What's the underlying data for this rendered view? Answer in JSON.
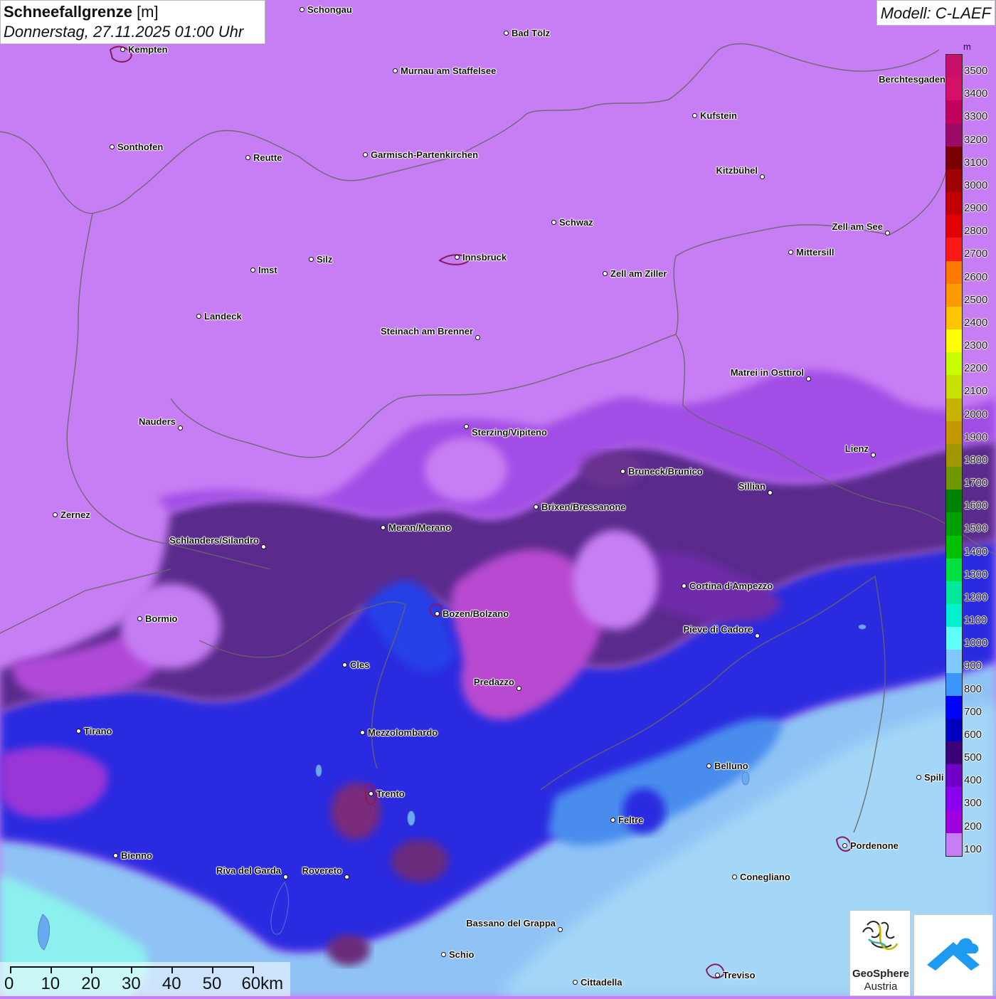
{
  "header": {
    "title_bold": "Schneefallgrenze",
    "title_unit": " [m]",
    "subtitle": "Donnerstag, 27.11.2025 01:00 Uhr",
    "model": "Modell: C-LAEF"
  },
  "cities": [
    {
      "name": "Schongau"
    },
    {
      "name": "Bad Tölz"
    },
    {
      "name": "Kempten"
    },
    {
      "name": "Murnau am Staffelsee"
    },
    {
      "name": "Berchtesgaden"
    },
    {
      "name": "Kufstein"
    },
    {
      "name": "Sonthofen"
    },
    {
      "name": "Reutte"
    },
    {
      "name": "Garmisch-Partenkirchen"
    },
    {
      "name": "Kitzbühel"
    },
    {
      "name": "Schwaz"
    },
    {
      "name": "Zell am See"
    },
    {
      "name": "Mittersill"
    },
    {
      "name": "Innsbruck"
    },
    {
      "name": "Silz"
    },
    {
      "name": "Imst"
    },
    {
      "name": "Zell am Ziller"
    },
    {
      "name": "Landeck"
    },
    {
      "name": "Steinach am Brenner"
    },
    {
      "name": "Matrei in Osttirol"
    },
    {
      "name": "Nauders"
    },
    {
      "name": "Sterzing/Vipiteno"
    },
    {
      "name": "Lienz"
    },
    {
      "name": "Bruneck/Brunico"
    },
    {
      "name": "Sillian"
    },
    {
      "name": "Brixen/Bressanone"
    },
    {
      "name": "Zernez"
    },
    {
      "name": "Meran/Merano"
    },
    {
      "name": "Schlanders/Silandro"
    },
    {
      "name": "Cortina d'Ampezzo"
    },
    {
      "name": "Bozen/Bolzano"
    },
    {
      "name": "Bormio"
    },
    {
      "name": "Pieve di Cadore"
    },
    {
      "name": "Cles"
    },
    {
      "name": "Predazzo"
    },
    {
      "name": "Tirano"
    },
    {
      "name": "Mezzolombardo"
    },
    {
      "name": "Belluno"
    },
    {
      "name": "Spili"
    },
    {
      "name": "Trento"
    },
    {
      "name": "Feltre"
    },
    {
      "name": "Pordenone"
    },
    {
      "name": "Bienno"
    },
    {
      "name": "Riva del Garda"
    },
    {
      "name": "Rovereto"
    },
    {
      "name": "Conegliano"
    },
    {
      "name": "Bassano del Grappa"
    },
    {
      "name": "Schio"
    },
    {
      "name": "Treviso"
    },
    {
      "name": "Cittadella"
    }
  ],
  "legend": {
    "unit": "m",
    "bands": [
      {
        "value": "3500",
        "color": "#c8106a"
      },
      {
        "value": "3400",
        "color": "#d41068"
      },
      {
        "value": "3300",
        "color": "#c2005e"
      },
      {
        "value": "3200",
        "color": "#9a0a66"
      },
      {
        "value": "3100",
        "color": "#7a0000"
      },
      {
        "value": "3000",
        "color": "#a00000"
      },
      {
        "value": "2900",
        "color": "#c20000"
      },
      {
        "value": "2800",
        "color": "#e20000"
      },
      {
        "value": "2700",
        "color": "#ff1818"
      },
      {
        "value": "2600",
        "color": "#ff7a00"
      },
      {
        "value": "2500",
        "color": "#ff9a00"
      },
      {
        "value": "2400",
        "color": "#ffc400"
      },
      {
        "value": "2300",
        "color": "#ffff00"
      },
      {
        "value": "2200",
        "color": "#c8ff00"
      },
      {
        "value": "2100",
        "color": "#c8e000"
      },
      {
        "value": "2000",
        "color": "#c8b400"
      },
      {
        "value": "1900",
        "color": "#c49600"
      },
      {
        "value": "1800",
        "color": "#a09600"
      },
      {
        "value": "1700",
        "color": "#6e9600"
      },
      {
        "value": "1600",
        "color": "#008200"
      },
      {
        "value": "1500",
        "color": "#00a000"
      },
      {
        "value": "1400",
        "color": "#00c000"
      },
      {
        "value": "1300",
        "color": "#00e040"
      },
      {
        "value": "1200",
        "color": "#00e89a"
      },
      {
        "value": "1100",
        "color": "#00f0d0"
      },
      {
        "value": "1000",
        "color": "#60ffff"
      },
      {
        "value": "900",
        "color": "#80c8ff"
      },
      {
        "value": "800",
        "color": "#3c96ff"
      },
      {
        "value": "700",
        "color": "#0000ff"
      },
      {
        "value": "600",
        "color": "#0000c0"
      },
      {
        "value": "500",
        "color": "#3c0078"
      },
      {
        "value": "400",
        "color": "#6e00c8"
      },
      {
        "value": "300",
        "color": "#8c00f0"
      },
      {
        "value": "200",
        "color": "#a000e0"
      },
      {
        "value": "100",
        "color": "#c77ef4"
      }
    ]
  },
  "scale": {
    "labels": [
      "0",
      "10",
      "20",
      "30",
      "40",
      "50",
      "60km"
    ]
  },
  "logos": {
    "geosphere_line1": "GeoSphere",
    "geosphere_line2": "Austria"
  }
}
